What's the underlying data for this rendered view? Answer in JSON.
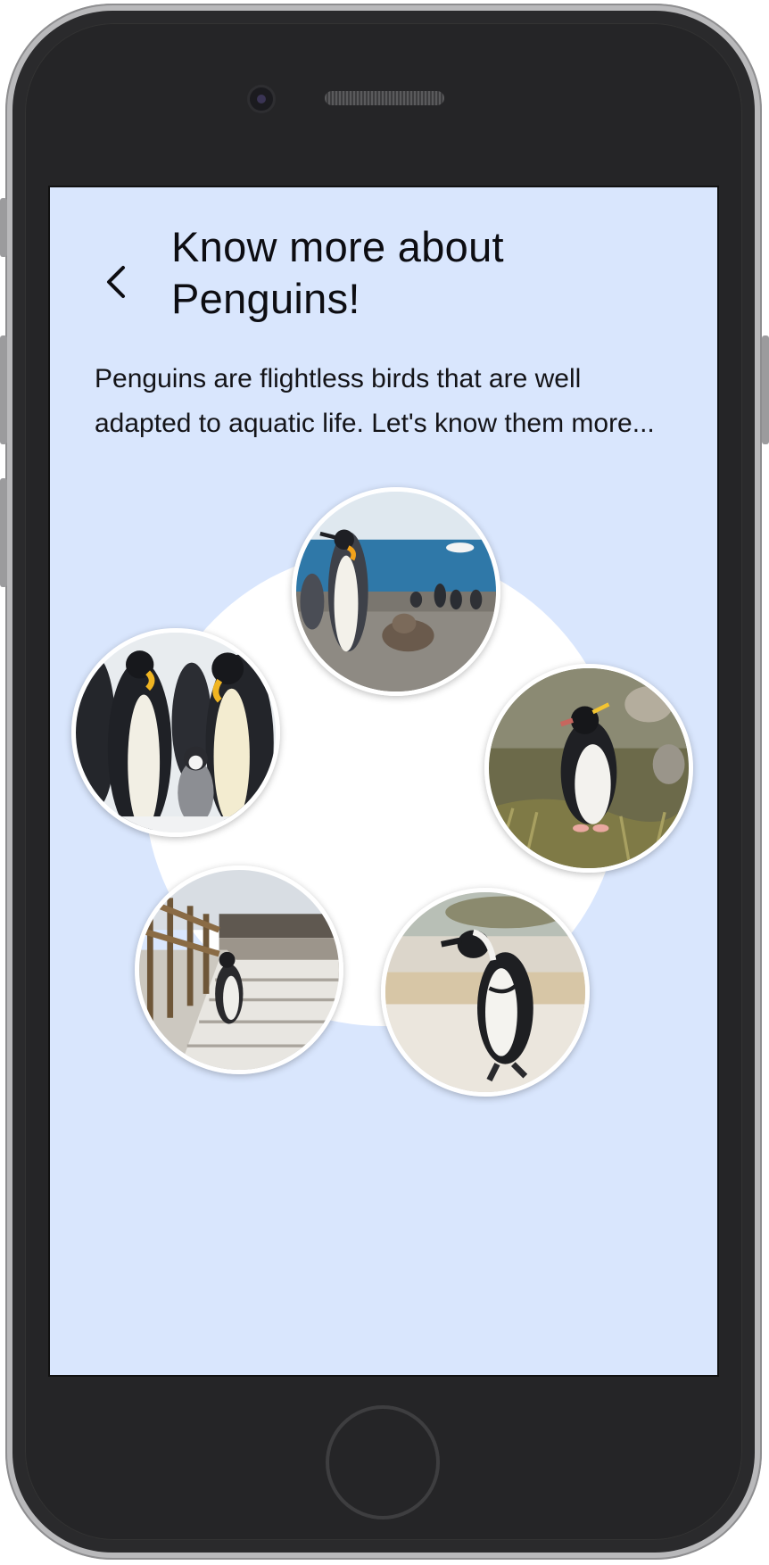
{
  "header": {
    "title": "Know more about Penguins!",
    "back_icon": "chevron-left-icon"
  },
  "intro": {
    "text": "Penguins are flightless birds that are well adapted to aquatic life. Let's know them more..."
  },
  "gallery": {
    "items": [
      {
        "name": "king-penguins-beach",
        "description": "King penguins on a beach"
      },
      {
        "name": "rockhopper-penguin-grass",
        "description": "Rockhopper penguin on grass"
      },
      {
        "name": "african-penguin-sand",
        "description": "African penguin walking on sand"
      },
      {
        "name": "magellanic-penguin-boardwalk",
        "description": "Penguin on a wooden boardwalk"
      },
      {
        "name": "emperor-penguins-colony",
        "description": "Emperor penguins with chick"
      }
    ]
  },
  "colors": {
    "screen_background": "#d9e6fd",
    "circle_background": "#ffffff",
    "text": "#0d0d12"
  }
}
